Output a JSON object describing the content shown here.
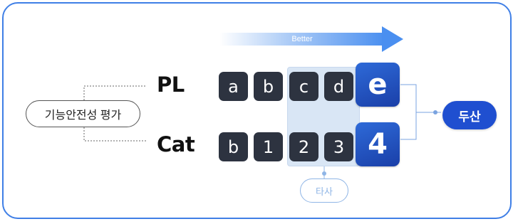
{
  "arrow": {
    "label": "Better"
  },
  "rows": [
    {
      "label": "PL",
      "cells": [
        "a",
        "b",
        "c",
        "d"
      ],
      "highlight": "e"
    },
    {
      "label": "Cat",
      "cells": [
        "b",
        "1",
        "2",
        "3"
      ],
      "highlight": "4"
    }
  ],
  "left_pill": "기능안전성 평가",
  "other_pill": "타사",
  "right_pill": "두산",
  "colors": {
    "frame": "#3f7fe6",
    "cell": "#2d3340",
    "accent": "#1f4fd0",
    "highlight_area": "#d9e6f5",
    "other_outline": "#8fb5e6"
  }
}
